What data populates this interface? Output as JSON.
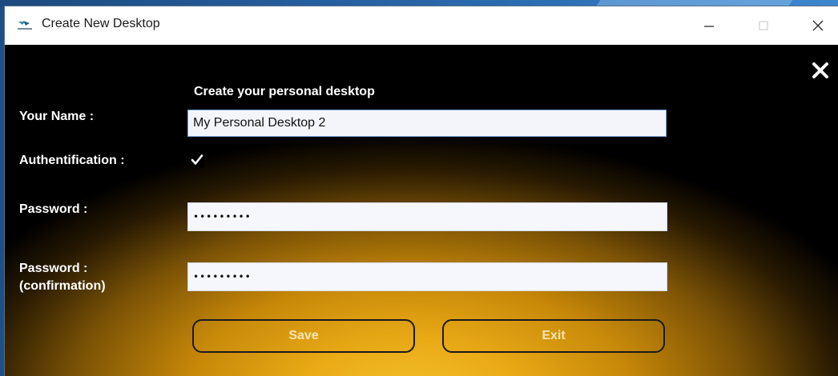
{
  "window": {
    "title": "Create New Desktop",
    "icon": "app-logo-icon"
  },
  "caption_buttons": [
    "minimize-icon",
    "maximize-icon",
    "close-icon"
  ],
  "form": {
    "heading": "Create your personal desktop",
    "name_label": "Your Name :",
    "name_value": "My Personal Desktop 2",
    "auth_label": "Authentification :",
    "auth_checked": true,
    "password_label": "Password :",
    "password_value": "•••••••••",
    "confirm_label_line1": "Password :",
    "confirm_label_line2": "(confirmation)",
    "confirm_value": "•••••••••"
  },
  "buttons": {
    "save_label": "Save",
    "exit_label": "Exit"
  },
  "colors": {
    "background": "#000000",
    "glow": "#f4bf2a",
    "label_text": "#ffffff",
    "button_text": "#f7e6b0"
  }
}
